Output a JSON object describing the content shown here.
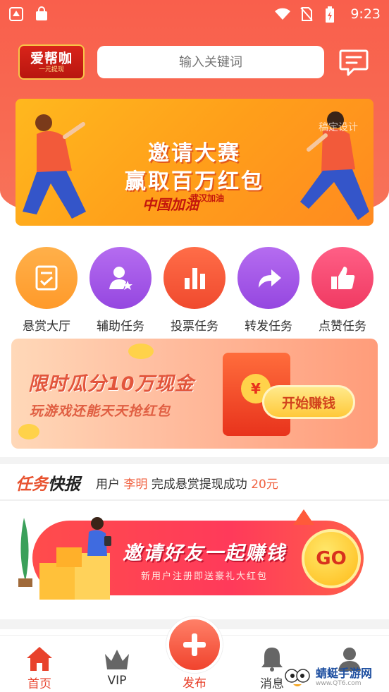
{
  "status_bar": {
    "time": "9:23"
  },
  "header": {
    "logo_text": "爱帮咖",
    "logo_sub": "一元提现",
    "search_placeholder": "输入关键词"
  },
  "banner": {
    "line1": "邀请大赛",
    "line2": "赢取百万红包",
    "slogan": "中国加油",
    "slogan_small": "武汉加油",
    "watermark": "稿定设计"
  },
  "categories": [
    {
      "label": "悬赏大厅",
      "icon": "document-check-icon",
      "color": "#ffa43a"
    },
    {
      "label": "辅助任务",
      "icon": "user-star-icon",
      "color": "#a25ae8"
    },
    {
      "label": "投票任务",
      "icon": "bar-chart-icon",
      "color": "#f95b3c"
    },
    {
      "label": "转发任务",
      "icon": "share-arrow-icon",
      "color": "#a25ae8"
    },
    {
      "label": "点赞任务",
      "icon": "thumbs-up-icon",
      "color": "#f6466e"
    }
  ],
  "promo": {
    "line1": "限时瓜分10万现金",
    "line2": "玩游戏还能天天抢红包",
    "button": "开始赚钱",
    "coin_symbol": "¥"
  },
  "news": {
    "title_a": "任务",
    "title_b": "快报",
    "text_prefix": "用户",
    "user": "李明",
    "text_mid": "完成悬赏提现成功",
    "amount": "20元"
  },
  "invite": {
    "line1": "邀请好友一起赚钱",
    "line2": "新用户注册即送豪礼大红包",
    "button": "GO"
  },
  "tabs": [
    {
      "label": "首页",
      "active": true
    },
    {
      "label": "VIP"
    },
    {
      "label": "发布",
      "active": true
    },
    {
      "label": "消息"
    },
    {
      "label": ""
    }
  ],
  "site_watermark": {
    "name": "蜻蜓手游网",
    "url": "www.QT6.com"
  },
  "colors": {
    "primary": "#f95f4c",
    "accent": "#ffb81e"
  }
}
